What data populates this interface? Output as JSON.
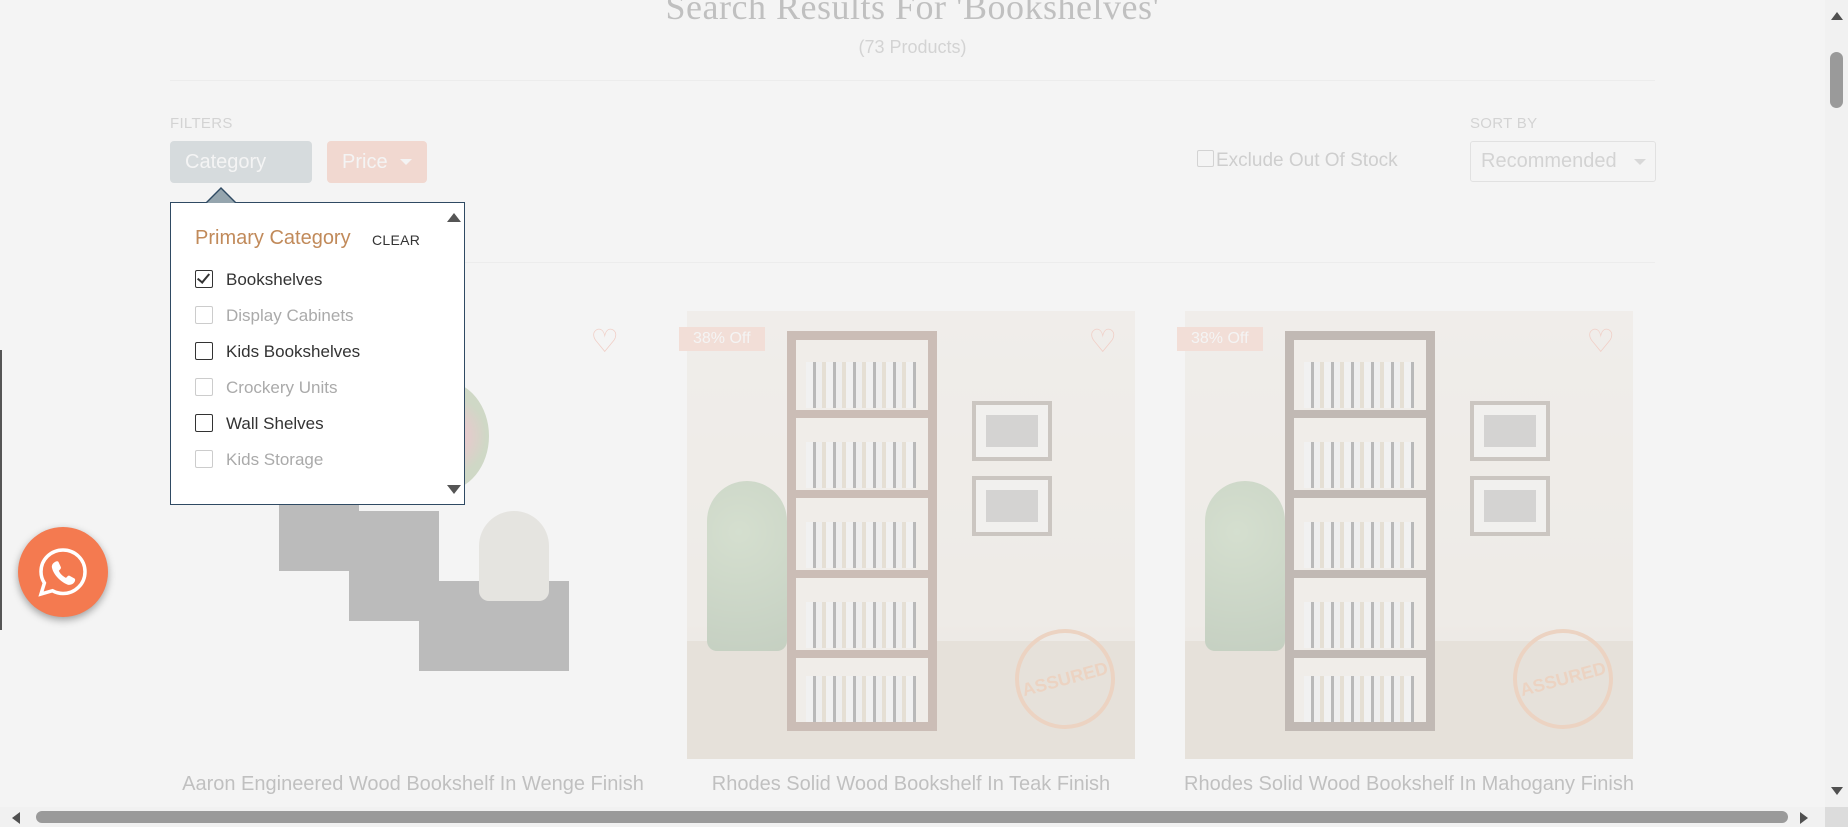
{
  "header": {
    "title": "Search Results For 'Bookshelves'",
    "count": "(73 Products)"
  },
  "filters": {
    "label": "FILTERS",
    "category_label": "Category",
    "price_label": "Price",
    "exclude_label": "Exclude Out Of Stock",
    "exclude_checked": false
  },
  "sort": {
    "label": "SORT BY",
    "value": "Recommended"
  },
  "category_popup": {
    "heading": "Primary Category",
    "clear_label": "CLEAR",
    "options": [
      {
        "label": "Bookshelves",
        "checked": true,
        "disabled": false
      },
      {
        "label": "Display Cabinets",
        "checked": false,
        "disabled": true
      },
      {
        "label": "Kids Bookshelves",
        "checked": false,
        "disabled": false
      },
      {
        "label": "Crockery Units",
        "checked": false,
        "disabled": true
      },
      {
        "label": "Wall Shelves",
        "checked": false,
        "disabled": false
      },
      {
        "label": "Kids Storage",
        "checked": false,
        "disabled": true
      }
    ]
  },
  "products": [
    {
      "name": "Aaron Engineered Wood Bookshelf In Wenge Finish",
      "badge": ""
    },
    {
      "name": "Rhodes Solid Wood Bookshelf In Teak Finish",
      "badge": "38% Off"
    },
    {
      "name": "Rhodes Solid Wood Bookshelf In Mahogany Finish",
      "badge": "38% Off"
    }
  ],
  "stamp_text": "ASSURED",
  "icons": {
    "wishlist": "heart-outline-icon",
    "chat": "whatsapp-icon"
  },
  "colors": {
    "accent": "#f47a50",
    "category_button": "#95a5ae",
    "price_button": "#f39a7d",
    "popup_heading": "#c18a5a"
  }
}
